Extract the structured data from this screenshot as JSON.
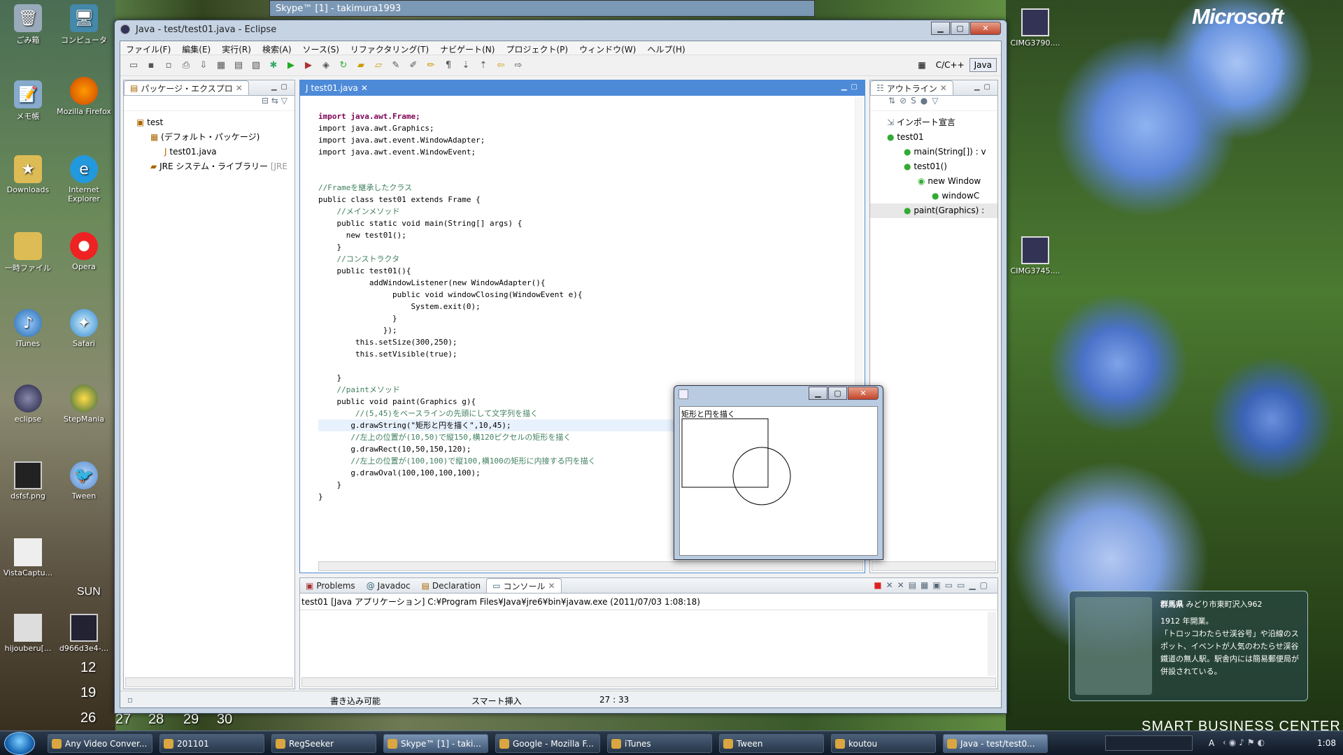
{
  "desktop": {
    "brand": "Microsoft",
    "icons": [
      {
        "label": "ごみ箱"
      },
      {
        "label": "コンピュータ"
      },
      {
        "label": "メモ帳"
      },
      {
        "label": "Mozilla Firefox"
      },
      {
        "label": "Downloads"
      },
      {
        "label": "Internet Explorer"
      },
      {
        "label": "一時ファイル"
      },
      {
        "label": "Opera"
      },
      {
        "label": "iTunes"
      },
      {
        "label": "Safari"
      },
      {
        "label": "eclipse"
      },
      {
        "label": "StepMania"
      },
      {
        "label": "dsfsf.png"
      },
      {
        "label": "Tween"
      },
      {
        "label": "VistaCaptu..."
      },
      {
        "label": "hijouberu[..."
      },
      {
        "label": "d966d3e4-..."
      },
      {
        "label": "CIMG3790...."
      },
      {
        "label": "CIMG3745...."
      }
    ],
    "calendar": {
      "day": "SUN",
      "dates": [
        "12",
        "19",
        "26",
        "27",
        "28",
        "29",
        "30"
      ]
    },
    "gadget": {
      "place_bold": "群馬県",
      "place": "みどり市東町沢入962",
      "year": "1912 年開業。",
      "desc": "「トロッコわたらせ渓谷号」や沿線のスポット、イベントが人気のわたらせ渓谷鐵道の無人駅。駅舎内には簡易郵便局が併設されている。"
    },
    "sbc": "SMART BUSINESS CENTER"
  },
  "background_windows": {
    "skype_title": "Skype™ [1] - takimura1993"
  },
  "eclipse": {
    "title": "Java - test/test01.java - Eclipse",
    "menu": [
      "ファイル(F)",
      "編集(E)",
      "実行(R)",
      "検索(A)",
      "ソース(S)",
      "リファクタリング(T)",
      "ナビゲート(N)",
      "プロジェクト(P)",
      "ウィンドウ(W)",
      "ヘルプ(H)"
    ],
    "perspectives": {
      "cpp": "C/C++",
      "java": "Java"
    },
    "package_explorer": {
      "tab": "パッケージ・エクスプロ",
      "items": [
        "test",
        "(デフォルト・パッケージ)",
        "test01.java",
        "JRE システム・ライブラリー",
        "[JRE"
      ]
    },
    "editor": {
      "tab": "test01.java",
      "lines": [
        "import java.awt.Frame;",
        "import java.awt.Graphics;",
        "import java.awt.event.WindowAdapter;",
        "import java.awt.event.WindowEvent;",
        "",
        "",
        "//Frameを継承したクラス",
        "public class test01 extends Frame {",
        "    //メインメソッド",
        "    public static void main(String[] args) {",
        "      new test01();",
        "    }",
        "    //コンストラクタ",
        "    public test01(){",
        "           addWindowListener(new WindowAdapter(){",
        "                public void windowClosing(WindowEvent e){",
        "                    System.exit(0);",
        "                }",
        "              });",
        "        this.setSize(300,250);",
        "        this.setVisible(true);",
        "",
        "    }",
        "    //paintメソッド",
        "    public void paint(Graphics g){",
        "        //(5,45)をベースラインの先頭にして文字列を描く",
        "       g.drawString(\"矩形と円を描く\",10,45);",
        "       //左上の位置が(10,50)で縦150,横120ピクセルの矩形を描く",
        "       g.drawRect(10,50,150,120);",
        "       //左上の位置が(100,100)で縦100,横100の矩形に内接する円を描く",
        "       g.drawOval(100,100,100,100);",
        "    }",
        "}"
      ]
    },
    "outline": {
      "tab": "アウトライン",
      "items": [
        "インポート宣言",
        "test01",
        "main(String[]) : v",
        "test01()",
        "new Window",
        "windowC",
        "paint(Graphics) :"
      ]
    },
    "console": {
      "tabs": [
        "Problems",
        "Javadoc",
        "Declaration",
        "コンソール"
      ],
      "header": "test01 [Java アプリケーション] C:¥Program Files¥Java¥jre6¥bin¥javaw.exe (2011/07/03 1:08:18)"
    },
    "status": {
      "writable": "書き込み可能",
      "insert": "スマート挿入",
      "position": "27 : 33"
    }
  },
  "java_frame": {
    "text": "矩形と円を描く"
  },
  "taskbar": {
    "tasks": [
      "Any Video Conver...",
      "201101",
      "RegSeeker",
      "Skype™ [1] - taki...",
      "Google - Mozilla F...",
      "iTunes",
      "Tween",
      "koutou",
      "Java - test/test0..."
    ],
    "clock": "1:08",
    "ime": "A"
  }
}
